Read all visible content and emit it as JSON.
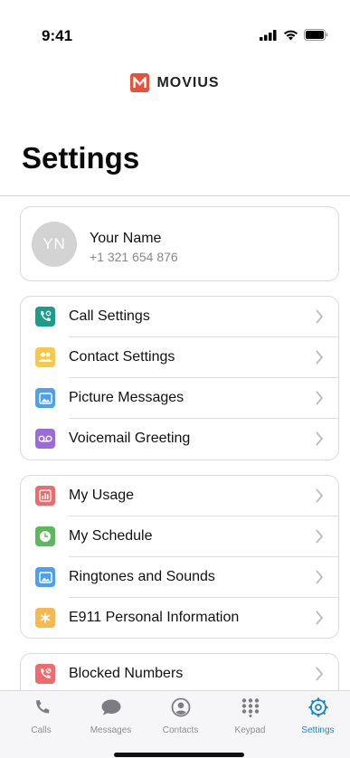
{
  "status": {
    "time": "9:41"
  },
  "logo": {
    "text": "MOVIUS"
  },
  "page": {
    "title": "Settings"
  },
  "profile": {
    "initials": "YN",
    "name": "Your Name",
    "phone": "+1 321 654 876"
  },
  "groups": [
    {
      "items": [
        {
          "label": "Call Settings",
          "icon": "phone-gear-icon",
          "color": "#1a9e8a"
        },
        {
          "label": "Contact Settings",
          "icon": "contacts-icon",
          "color": "#f7c948"
        },
        {
          "label": "Picture Messages",
          "icon": "picture-icon",
          "color": "#4d9ff0"
        },
        {
          "label": "Voicemail Greeting",
          "icon": "voicemail-icon",
          "color": "#9b6bdc"
        }
      ]
    },
    {
      "items": [
        {
          "label": "My Usage",
          "icon": "usage-chart-icon",
          "color": "#ef6a6a"
        },
        {
          "label": "My Schedule",
          "icon": "clock-icon",
          "color": "#5cb85c"
        },
        {
          "label": "Ringtones and Sounds",
          "icon": "picture-icon",
          "color": "#4d9ff0"
        },
        {
          "label": "E911 Personal Information",
          "icon": "asterisk-icon",
          "color": "#f8b84e"
        }
      ]
    },
    {
      "items": [
        {
          "label": "Blocked Numbers",
          "icon": "blocked-phone-icon",
          "color": "#ef6a6a"
        }
      ]
    }
  ],
  "tabs": [
    {
      "label": "Calls",
      "icon": "phone-icon",
      "active": false
    },
    {
      "label": "Messages",
      "icon": "chat-bubble-icon",
      "active": false
    },
    {
      "label": "Contacts",
      "icon": "person-circle-icon",
      "active": false
    },
    {
      "label": "Keypad",
      "icon": "keypad-icon",
      "active": false
    },
    {
      "label": "Settings",
      "icon": "gear-icon",
      "active": true
    }
  ],
  "colors": {
    "accent": "#1d84d6",
    "brand": "#e5533d"
  }
}
